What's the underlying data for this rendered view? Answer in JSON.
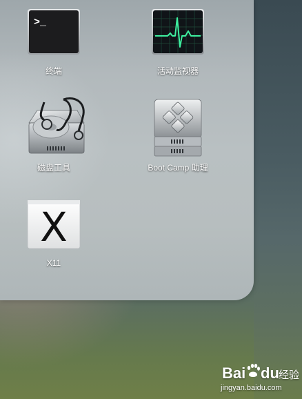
{
  "folder": {
    "apps": [
      {
        "id": "terminal",
        "label": "终端",
        "icon": "terminal-icon",
        "glyph": ">_"
      },
      {
        "id": "activity-monitor",
        "label": "活动监视器",
        "icon": "activity-monitor-icon"
      },
      {
        "id": "disk-utility",
        "label": "磁盘工具",
        "icon": "disk-utility-icon"
      },
      {
        "id": "boot-camp",
        "label": "Boot Camp 助理",
        "icon": "boot-camp-icon"
      },
      {
        "id": "x11",
        "label": "X11",
        "icon": "x11-icon",
        "glyph": "X"
      }
    ]
  },
  "watermark": {
    "logo_text": "Bai",
    "logo_text_2": "du",
    "cn_text": "经验",
    "url": "jingyan.baidu.com"
  }
}
